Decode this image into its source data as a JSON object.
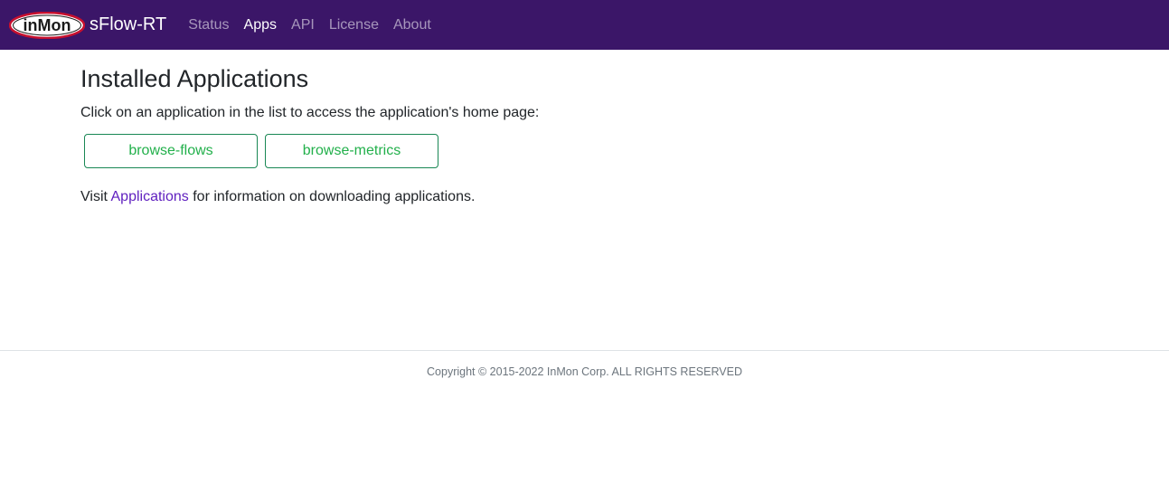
{
  "navbar": {
    "logo_text": "inMon",
    "brand": "sFlow-RT",
    "items": [
      {
        "label": "Status",
        "active": false
      },
      {
        "label": "Apps",
        "active": true
      },
      {
        "label": "API",
        "active": false
      },
      {
        "label": "License",
        "active": false
      },
      {
        "label": "About",
        "active": false
      }
    ]
  },
  "main": {
    "title": "Installed Applications",
    "intro": "Click on an application in the list to access the application's home page:",
    "apps": [
      "browse-flows",
      "browse-metrics"
    ],
    "visit_prefix": "Visit ",
    "visit_link": "Applications",
    "visit_suffix": " for information on downloading applications."
  },
  "footer": {
    "copyright": "Copyright © 2015-2022 InMon Corp. ALL RIGHTS RESERVED"
  },
  "colors": {
    "navbar_bg": "#3b1668",
    "app_button_text": "#22b04b",
    "link": "#5f1fbf"
  }
}
